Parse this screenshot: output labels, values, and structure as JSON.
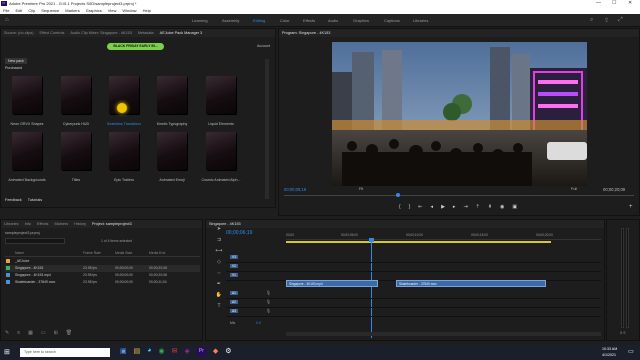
{
  "titlebar": {
    "title": "Adobe Premiere Pro 2021 - G:\\5.1 Projects S0D\\sampleproject3.prproj *",
    "controls": [
      "—",
      "☐",
      "✕"
    ]
  },
  "menu": [
    "File",
    "Edit",
    "Clip",
    "Sequence",
    "Markers",
    "Graphics",
    "View",
    "Window",
    "Help"
  ],
  "workspaces": [
    "Learning",
    "Assembly",
    "Editing",
    "Color",
    "Effects",
    "Audio",
    "Graphics",
    "Captions",
    "Libraries"
  ],
  "source_tabs": [
    "Source: (no clips)",
    "Effect Controls",
    "Audio Clip Mixer: Singapore - 4K153",
    "Metadata",
    "AEJuice Pack Manager 3"
  ],
  "extension": {
    "promo_label": "BLACK FRIDAY EARLY BI...",
    "account_label": "Account",
    "tab_label": "New pack",
    "section_label": "Purchased",
    "packs_row1": [
      "Neon GRVX Shapes",
      "Cyberpunk HUD",
      "Seamless Transitions",
      "Kinetic Typography",
      "Liquid Elements"
    ],
    "packs_row2": [
      "Animated Backgrounds",
      "Titles",
      "Epic Trailers",
      "Animated Emoji",
      "Cosmic Animated Alph..."
    ]
  },
  "source_bottom_tabs": [
    "Feedback",
    "Tutorials"
  ],
  "program": {
    "title": "Program: Singapore - 4K153",
    "timecode_left": "00;00;06;19",
    "fit": "Fit",
    "ratio": "Full",
    "timecode_right": "00;00;20;09"
  },
  "project": {
    "tabs": [
      "Libraries",
      "Info",
      "Effects",
      "Markers",
      "History",
      "Project: sampleproject3"
    ],
    "file": "sampleproject3.prproj",
    "count": "1 of 4 items selected",
    "columns": [
      "Name",
      "Frame Rate",
      "Media Start",
      "Media End"
    ],
    "rows": [
      {
        "name": "_AEJuice",
        "fps": "",
        "start": "",
        "end": "",
        "color": "#e8a23a"
      },
      {
        "name": "Singapore - 4K153",
        "fps": "23.98 fps",
        "start": "00;00;00;00",
        "end": "00;00;20;08",
        "color": "#3bb55c"
      },
      {
        "name": "Singapore - 4K153.mp4",
        "fps": "23.98 fps",
        "start": "00;00;00;00",
        "end": "00;00;20;08",
        "color": "#4f8fd6"
      },
      {
        "name": "Skateboarder - 37849.mov",
        "fps": "23.98 fps",
        "start": "00;00;00;00",
        "end": "00;00;11;04",
        "color": "#4f8fd6"
      }
    ]
  },
  "timeline": {
    "tab": "Singapore - 4K153",
    "timecode": "00;00;06;19",
    "ruler": [
      "00;00",
      "00;00;05;00",
      "00;00;10;00",
      "00;00;15;00",
      "00;00;20;00"
    ],
    "tracks_video": [
      "V3",
      "V2",
      "V1"
    ],
    "tracks_audio": [
      "A1",
      "A2",
      "A3"
    ],
    "master_label": "Mix",
    "master_value": "0.0",
    "clip1": "Singapore - 4K153.mp4",
    "clip2": "Skateboarder - 37849.mov"
  },
  "meter_label": "S S",
  "taskbar": {
    "time": "10:33 AM",
    "date": "4/1/2021",
    "search_placeholder": "Type here to search"
  },
  "colors": {
    "accent": "#2d8ceb",
    "promo": "#7bd24a",
    "clip": "#3a6aa8"
  }
}
